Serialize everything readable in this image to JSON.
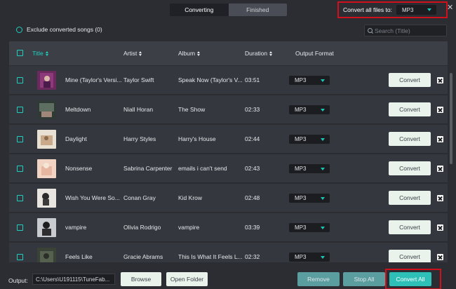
{
  "tabs": {
    "converting": "Converting",
    "finished": "Finished"
  },
  "convert_all_files": {
    "label": "Convert all files to:",
    "format": "MP3"
  },
  "window": {
    "close_glyph": "✕"
  },
  "exclude": {
    "label": "Exclude converted songs (0)"
  },
  "search": {
    "placeholder": "Search  (Title)"
  },
  "table": {
    "headers": {
      "title": "Title",
      "artist": "Artist",
      "album": "Album",
      "duration": "Duration",
      "output_format": "Output Format"
    },
    "rows": [
      {
        "title": "Mine (Taylor's Versi...",
        "artist": "Taylor Swift",
        "album": "Speak Now (Taylor's V...",
        "duration": "03:51",
        "format": "MP3",
        "convert": "Convert"
      },
      {
        "title": "Meltdown",
        "artist": "Niall Horan",
        "album": "The Show",
        "duration": "02:33",
        "format": "MP3",
        "convert": "Convert"
      },
      {
        "title": "Daylight",
        "artist": "Harry Styles",
        "album": "Harry's House",
        "duration": "02:44",
        "format": "MP3",
        "convert": "Convert"
      },
      {
        "title": "Nonsense",
        "artist": "Sabrina Carpenter",
        "album": "emails i can't send",
        "duration": "02:43",
        "format": "MP3",
        "convert": "Convert"
      },
      {
        "title": "Wish You Were So...",
        "artist": "Conan Gray",
        "album": "Kid Krow",
        "duration": "02:48",
        "format": "MP3",
        "convert": "Convert"
      },
      {
        "title": "vampire",
        "artist": "Olivia Rodrigo",
        "album": "vampire",
        "duration": "03:39",
        "format": "MP3",
        "convert": "Convert"
      },
      {
        "title": "Feels Like",
        "artist": "Gracie Abrams",
        "album": "This Is What It Feels L...",
        "duration": "02:32",
        "format": "MP3",
        "convert": "Convert"
      }
    ]
  },
  "footer": {
    "output_label": "Output:",
    "output_path": "C:\\Users\\U191115\\TuneFab...",
    "browse": "Browse",
    "open_folder": "Open Folder",
    "remove": "Remove",
    "stop_all": "Stop All",
    "convert_all": "Convert All"
  },
  "colors": {
    "accent": "#1fd0c0",
    "highlight_border": "#d0111b",
    "background": "#2b2d33",
    "row": "#34373d"
  }
}
